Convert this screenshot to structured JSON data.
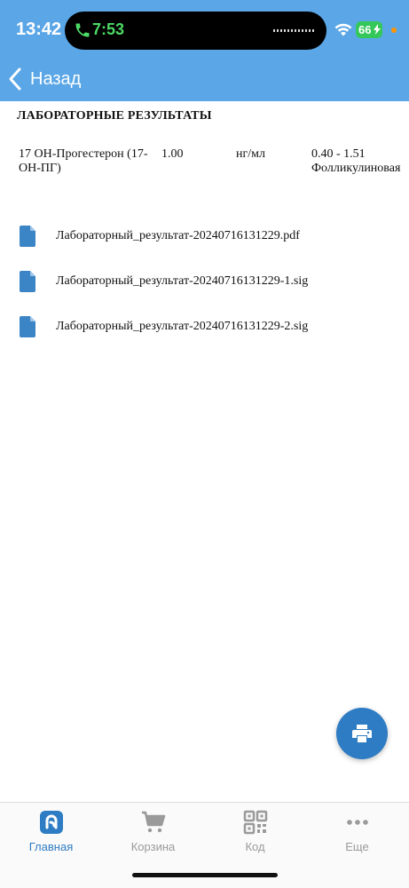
{
  "status_bar": {
    "time": "13:42",
    "call_time": "7:53",
    "battery": "66",
    "colors": {
      "call": "#4cd964",
      "battery": "#34c759",
      "recording_dot": "#ff9500"
    }
  },
  "header": {
    "back_label": "Назад",
    "background": "#5aa6e6"
  },
  "section_title": "ЛАБОРАТОРНЫЕ РЕЗУЛЬТАТЫ",
  "results": [
    {
      "name": "17 ОН-Прогестерон (17-ОН-ПГ)",
      "value": "1.00",
      "unit": "нг/мл",
      "range": "0.40 - 1.51 Фолликулиновая"
    }
  ],
  "files": [
    {
      "name": "Лабораторный_результат-20240716131229.pdf",
      "icon": "document-icon"
    },
    {
      "name": "Лабораторный_результат-20240716131229-1.sig",
      "icon": "document-icon"
    },
    {
      "name": "Лабораторный_результат-20240716131229-2.sig",
      "icon": "document-icon"
    }
  ],
  "fab": {
    "icon": "print-icon",
    "color": "#2e7cc4"
  },
  "tabs": [
    {
      "label": "Главная",
      "icon": "home-logo-icon",
      "active": true
    },
    {
      "label": "Корзина",
      "icon": "cart-icon",
      "active": false
    },
    {
      "label": "Код",
      "icon": "qr-code-icon",
      "active": false
    },
    {
      "label": "Еще",
      "icon": "more-icon",
      "active": false
    }
  ]
}
